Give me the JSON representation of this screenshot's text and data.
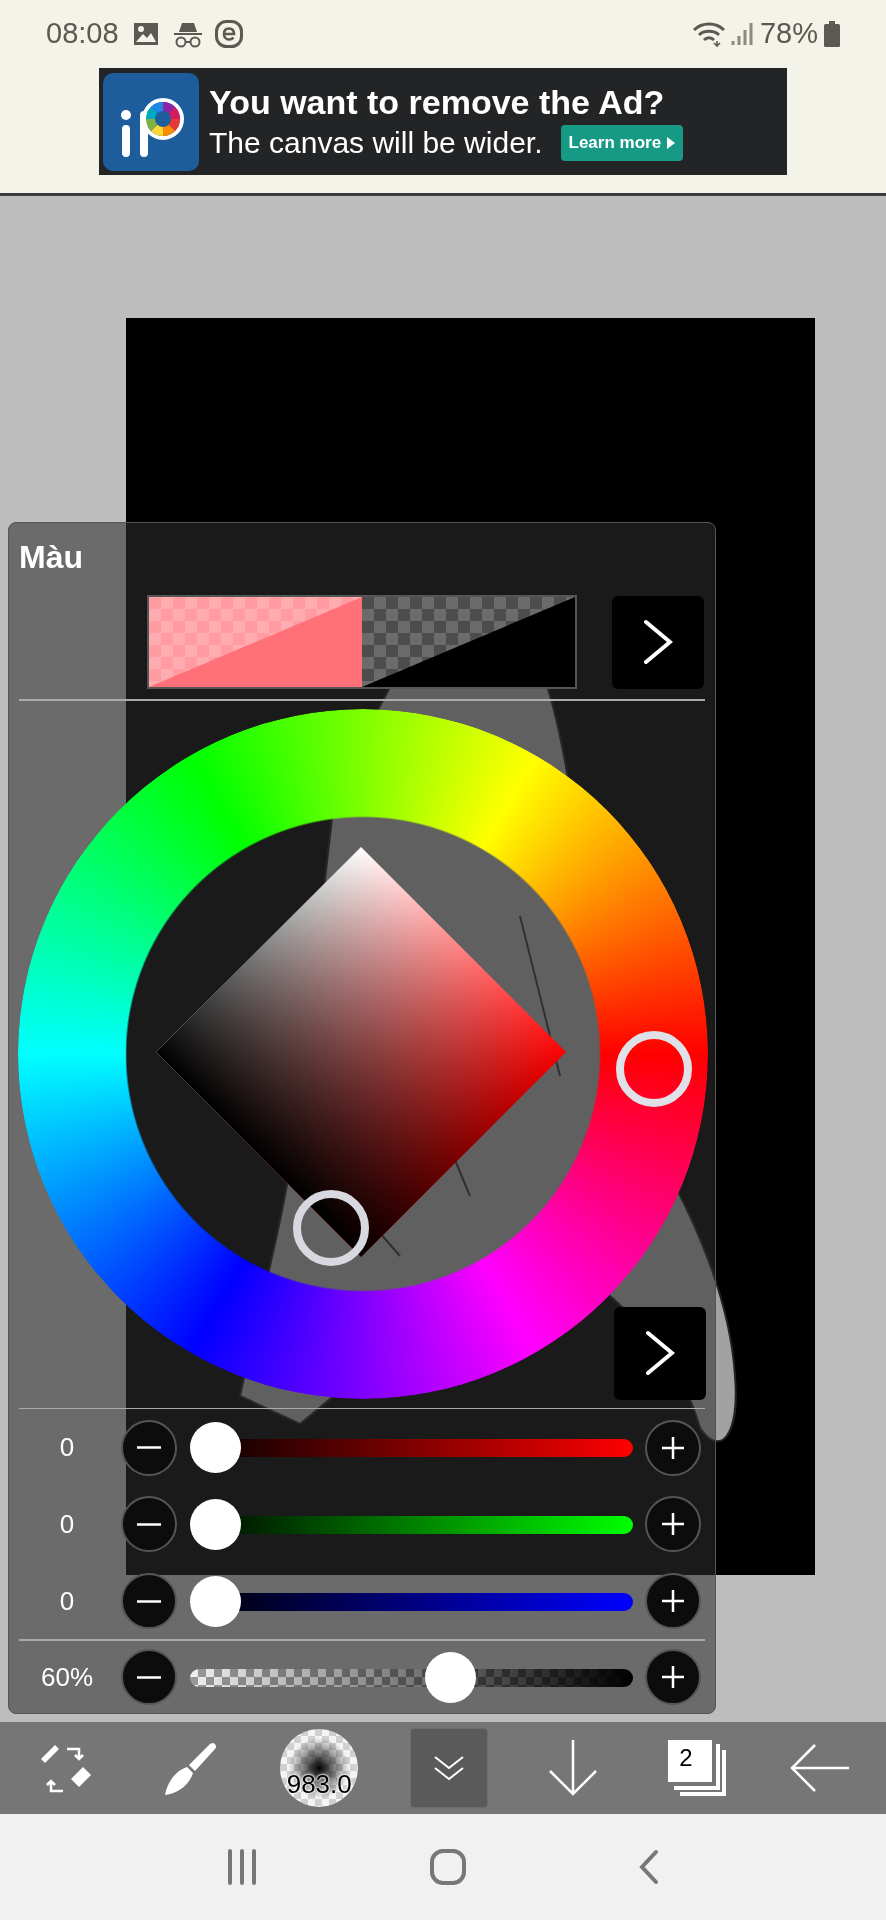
{
  "status_bar": {
    "time": "08:08",
    "battery": "78%"
  },
  "ad": {
    "headline": "You want to remove the Ad?",
    "subline": "The canvas will be wider.",
    "button": "Learn more"
  },
  "color_panel": {
    "title": "Màu",
    "swatches": [
      {
        "color": "#ff7079"
      },
      {
        "color": "#000000"
      }
    ],
    "sliders": [
      {
        "kind": "red",
        "reading": "0",
        "level": 0
      },
      {
        "kind": "green",
        "reading": "0",
        "level": 0
      },
      {
        "kind": "blue",
        "reading": "0",
        "level": 0
      }
    ],
    "opacity": {
      "reading": "60%",
      "level": 0.6
    }
  },
  "toolbar": [
    {
      "kind": "transform",
      "selected": false
    },
    {
      "kind": "brush",
      "selected": false
    },
    {
      "kind": "brush_size",
      "label": "983.0",
      "selected": false
    },
    {
      "kind": "collapse",
      "selected": true
    },
    {
      "kind": "move_down",
      "selected": false
    },
    {
      "kind": "layers",
      "label": "2",
      "selected": false
    },
    {
      "kind": "back",
      "selected": false
    }
  ]
}
